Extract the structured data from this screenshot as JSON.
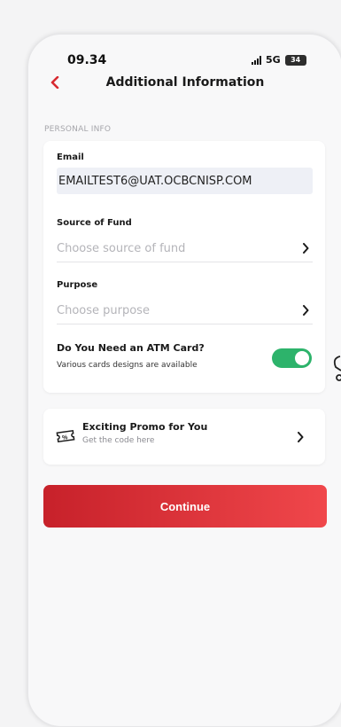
{
  "status_bar": {
    "time": "09.34",
    "network": "5G",
    "battery": "34"
  },
  "header": {
    "title": "Additional Information"
  },
  "personal_info": {
    "section_label": "PERSONAL INFO",
    "email": {
      "label": "Email",
      "value": "EMAILTEST6@UAT.OCBCNISP.COM"
    },
    "source_of_fund": {
      "label": "Source of Fund",
      "placeholder": "Choose source of fund"
    },
    "purpose": {
      "label": "Purpose",
      "placeholder": "Choose purpose"
    },
    "atm_card": {
      "title": "Do You Need an ATM Card?",
      "subtitle": "Various cards designs are available",
      "enabled": true
    }
  },
  "promo": {
    "title": "Exciting Promo for You",
    "subtitle": "Get the code here"
  },
  "continue_button": {
    "label": "Continue"
  },
  "colors": {
    "accent": "#d72a31",
    "toggle_on": "#2db36b",
    "input_bg": "#eef0f6"
  },
  "icons": {
    "back": "chevron-left-icon",
    "row": "chevron-right-icon",
    "promo": "voucher-icon"
  }
}
